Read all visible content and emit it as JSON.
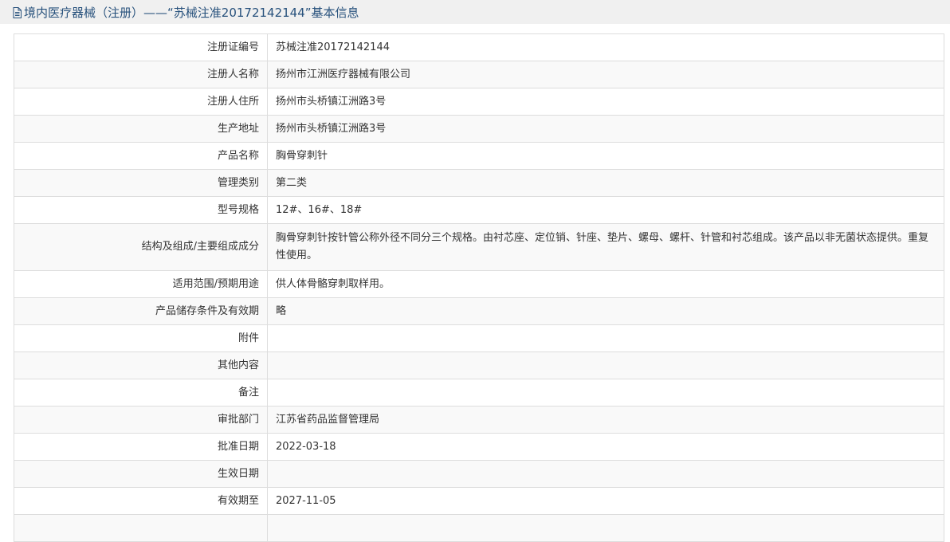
{
  "header": {
    "title": "境内医疗器械（注册）——“苏械注准20172142144”基本信息"
  },
  "rows": [
    {
      "label": "注册证编号",
      "value": "苏械注准20172142144"
    },
    {
      "label": "注册人名称",
      "value": "扬州市江洲医疗器械有限公司"
    },
    {
      "label": "注册人住所",
      "value": "扬州市头桥镇江洲路3号"
    },
    {
      "label": "生产地址",
      "value": "扬州市头桥镇江洲路3号"
    },
    {
      "label": "产品名称",
      "value": "胸骨穿刺针"
    },
    {
      "label": "管理类别",
      "value": "第二类"
    },
    {
      "label": "型号规格",
      "value": "12#、16#、18#"
    },
    {
      "label": "结构及组成/主要组成成分",
      "value": "胸骨穿刺针按针管公称外径不同分三个规格。由衬芯座、定位销、针座、垫片、螺母、螺杆、针管和衬芯组成。该产品以非无菌状态提供。重复性使用。"
    },
    {
      "label": "适用范围/预期用途",
      "value": "供人体骨骼穿刺取样用。"
    },
    {
      "label": "产品储存条件及有效期",
      "value": "略"
    },
    {
      "label": "附件",
      "value": ""
    },
    {
      "label": "其他内容",
      "value": ""
    },
    {
      "label": "备注",
      "value": ""
    },
    {
      "label": "审批部门",
      "value": "江苏省药品监督管理局"
    },
    {
      "label": "批准日期",
      "value": "2022-03-18"
    },
    {
      "label": "生效日期",
      "value": ""
    },
    {
      "label": "有效期至",
      "value": "2027-11-05"
    },
    {
      "label": "",
      "value": ""
    }
  ]
}
